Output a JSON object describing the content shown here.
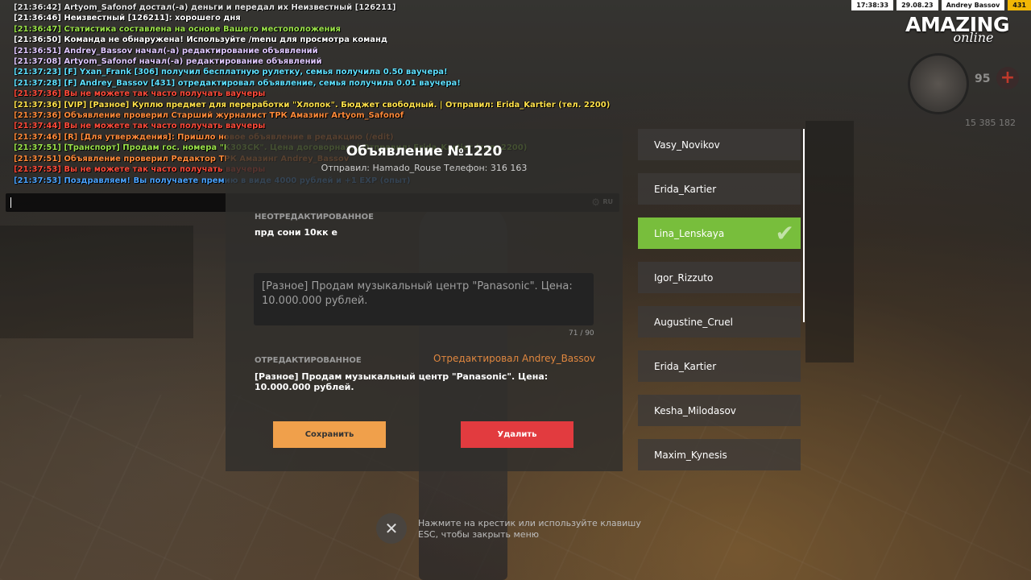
{
  "hud": {
    "time": "17:38:33",
    "date": "29.08.23",
    "player": "Andrey Bassov",
    "level": "431",
    "logo_top": "AMAZING",
    "logo_bottom": "online",
    "health": "95",
    "health_icon": "plus-icon",
    "money": "15 385 182"
  },
  "chat": {
    "lines": [
      {
        "text": "[21:36:42] Artyom_Safonof достал(-а) деньги и передал их Неизвестный [126211]",
        "color": "#e8e8e8"
      },
      {
        "text": "[21:36:46] Неизвестный [126211]: хорошего дня",
        "color": "#ffffff"
      },
      {
        "text": "[21:36:47] Статистика составлена на основе Вашего местоположения",
        "color": "#9be34a"
      },
      {
        "text": "[21:36:50] Команда не обнаружена! Используйте /menu для просмотра команд",
        "color": "#ffffff"
      },
      {
        "text": "[21:36:51] Andrey_Bassov начал(-а) редактирование объявлений",
        "color": "#e0c8ff"
      },
      {
        "text": "[21:37:08] Artyom_Safonof начал(-а) редактирование объявлений",
        "color": "#e0c8ff"
      },
      {
        "text": "[21:37:23] [F] Yxan_Frank [306] получил бесплатную рулетку, семья получила 0.50 ваучера!",
        "color": "#5ee0ff"
      },
      {
        "text": "[21:37:28] [F] Andrey_Bassov [431] отредактировал объявление, семья получила 0.01 ваучера!",
        "color": "#5ee0ff"
      },
      {
        "text": "[21:37:36] Вы не можете так часто получать ваучеры",
        "color": "#ff4b3a"
      },
      {
        "text": "[21:37:36] [VIP] [Разное] Куплю предмет для переработки \"Хлопок\". Бюджет свободный. | Отправил: Erida_Kartier (тел. 2200)",
        "color": "#ffe14a"
      },
      {
        "text": "[21:37:36] Объявление проверил Старший журналист ТРК Амазинг Artyom_Safonof",
        "color": "#ff8a3a"
      },
      {
        "text": "[21:37:44] Вы не можете так часто получать ваучеры",
        "color": "#ff4b3a"
      },
      {
        "text": "[21:37:46] [R] [Для утверждения]: Пришло новое объявление в редакцию (/edit)",
        "color": "#ff8a3a"
      },
      {
        "text": "[21:37:51] [Транспорт] Продам гос. номера \"К303СК\". Цена договорная. | Отправил: Erida_Kartier (тел. 2200)",
        "color": "#9be34a"
      },
      {
        "text": "[21:37:51] Объявление проверил Редактор ТРК Амазинг Andrey_Bassov",
        "color": "#ff8a3a"
      },
      {
        "text": "[21:37:53] Вы не можете так часто получать ваучеры",
        "color": "#ff4b3a"
      },
      {
        "text": "[21:37:53] Поздравляем! Вы получаете премию в виде 4000 рублей и +1 EXP (опыт)",
        "color": "#4aa3ff"
      }
    ],
    "lang": "RU",
    "settings_icon": "gear-icon"
  },
  "ad": {
    "title": "Объявление №1220",
    "sender": "Отправил: Hamado_Rouse Телефон: 316 163",
    "original_label": "НЕОТРЕДАКТИРОВАННОЕ",
    "original_text": "прд сони 10кк е",
    "edit_value": "[Разное] Продам музыкальный центр \"Panasonic\". Цена: 10.000.000 рублей.",
    "counter": "71 / 90",
    "edited_label": "ОТРЕДАКТИРОВАННОЕ",
    "edited_by": "Отредактировал Andrey_Bassov",
    "edited_text": "[Разное] Продам музыкальный центр \"Panasonic\". Цена: 10.000.000 рублей.",
    "save_label": "Сохранить",
    "delete_label": "Удалить"
  },
  "users": [
    {
      "name": "Vasy_Novikov",
      "active": false
    },
    {
      "name": "Erida_Kartier",
      "active": false
    },
    {
      "name": "Lina_Lenskaya",
      "active": true
    },
    {
      "name": "Igor_Rizzuto",
      "active": false
    },
    {
      "name": "Augustine_Cruel",
      "active": false
    },
    {
      "name": "Erida_Kartier",
      "active": false
    },
    {
      "name": "Kesha_Milodasov",
      "active": false
    },
    {
      "name": "Maxim_Kynesis",
      "active": false
    }
  ],
  "close": {
    "icon": "close-icon",
    "hint": "Нажмите на крестик или используйте клавишу ESC, чтобы закрыть меню"
  }
}
